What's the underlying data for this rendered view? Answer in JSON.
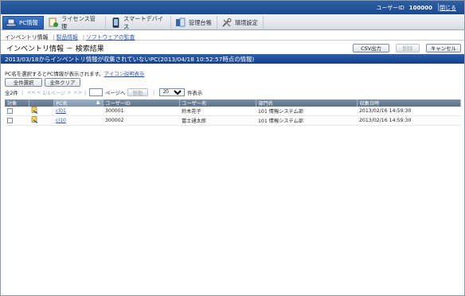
{
  "topbar": {
    "user_label": "ユーザーID",
    "user_id": "100000",
    "close_label": "閉じる"
  },
  "tabs": [
    {
      "label": "PC情報",
      "icon": "pc-info-icon",
      "active": true
    },
    {
      "label": "ライセンス管理",
      "icon": "license-icon",
      "active": false
    },
    {
      "label": "スマートデバイス",
      "icon": "smart-device-icon",
      "active": false
    },
    {
      "label": "管理台帳",
      "icon": "ledger-icon",
      "active": false
    },
    {
      "label": "環境設定",
      "icon": "settings-icon",
      "active": false
    }
  ],
  "subnav": {
    "current": "インベントリ情報",
    "link1": "製品情報",
    "link2": "ソフトウェアの監査"
  },
  "page": {
    "title": "インベントリ情報 － 検索結果",
    "csv_button": "CSV出力",
    "delete_button": "削除",
    "cancel_button": "キャンセル"
  },
  "banner": "2013/03/18からインベントリ情報が収集されていないPC(2013/04/18 10:52:57時点の情報)",
  "hint": {
    "text": "PC名を選択するとPC情報が表示されます。",
    "link": "アイコン説明表示"
  },
  "actions": {
    "select_all": "全件選択",
    "clear_all": "全件クリア"
  },
  "pager": {
    "total": "全2件",
    "first": "<<",
    "prev": "<",
    "page_info": "1/1ページ",
    "next": ">",
    "last": ">>",
    "page_input": "",
    "goto_label": "ページへ",
    "move_button": "移動",
    "per_page_selected": "20",
    "per_page_suffix": "件表示"
  },
  "table": {
    "headers": [
      "対象",
      "",
      "PC名",
      "ユーザーID",
      "ユーザー名",
      "部門名",
      "収集日時"
    ],
    "rows": [
      {
        "pc": "cl01",
        "user_id": "300001",
        "user_name": "鈴木花子",
        "dept": "101 情報システム部",
        "date": "2013/02/16 14:59:30"
      },
      {
        "pc": "cl10",
        "user_id": "300002",
        "user_name": "富士通太郎",
        "dept": "101 情報システム部",
        "date": "2013/02/16 14:59:30"
      }
    ]
  }
}
